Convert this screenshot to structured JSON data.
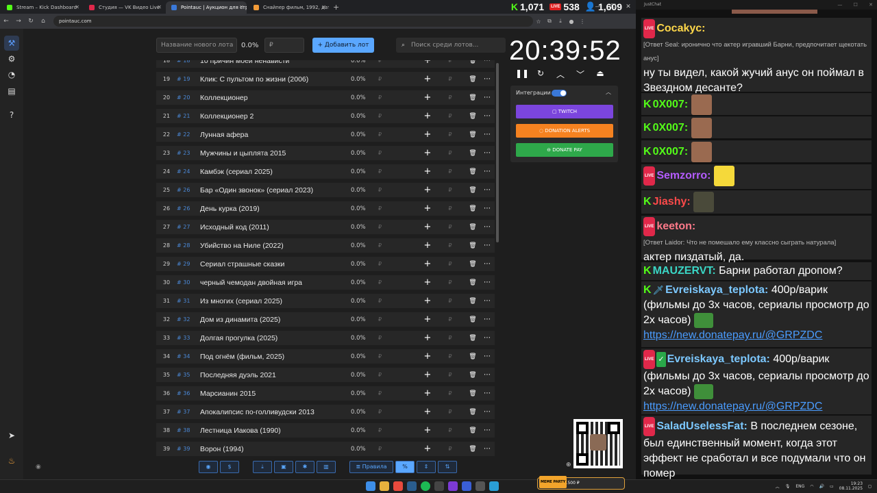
{
  "browser": {
    "tabs": [
      {
        "title": "Stream – Kick Dashboard",
        "color": "#53fc18"
      },
      {
        "title": "Студия — VK Видео Live",
        "color": "#e0284a"
      },
      {
        "title": "Pointauc | Аукцион для стрим...",
        "color": "#3a78d8"
      },
      {
        "title": "Снайпер фильм, 1992, дата вы...",
        "color": "#f29b38"
      }
    ],
    "url": "pointauc.com",
    "viewer_stats": {
      "kick": "1,071",
      "vk": "538",
      "total": "1,609"
    }
  },
  "sidebar": {
    "items": [
      "auction-icon",
      "settings-icon",
      "wheel-icon",
      "rules-icon",
      "help-icon"
    ],
    "bottom": [
      "telegram-icon",
      "donate-icon"
    ]
  },
  "toolbar": {
    "lot_placeholder": "Название нового лота",
    "percent": "0.0%",
    "amount_placeholder": "₽",
    "add_label": "Добавить лот",
    "search_placeholder": "Поиск среди лотов..."
  },
  "lots": [
    {
      "n": "18",
      "id": "18",
      "name": "10 причин моей ненависти"
    },
    {
      "n": "19",
      "id": "19",
      "name": "Клик: С пультом по жизни (2006)"
    },
    {
      "n": "20",
      "id": "20",
      "name": "Коллекционер"
    },
    {
      "n": "21",
      "id": "21",
      "name": "Коллекционер 2"
    },
    {
      "n": "22",
      "id": "22",
      "name": "Лунная афера"
    },
    {
      "n": "23",
      "id": "23",
      "name": "Мужчины и цыплята 2015"
    },
    {
      "n": "24",
      "id": "24",
      "name": "Камбэк (сериал 2025)"
    },
    {
      "n": "25",
      "id": "26",
      "name": "Бар «Один звонок» (сериал 2023)"
    },
    {
      "n": "26",
      "id": "26",
      "name": "День курка (2019)"
    },
    {
      "n": "27",
      "id": "27",
      "name": "Исходный код (2011)"
    },
    {
      "n": "28",
      "id": "28",
      "name": "Убийство на Ниле (2022)"
    },
    {
      "n": "29",
      "id": "29",
      "name": "Сериал страшные сказки"
    },
    {
      "n": "30",
      "id": "30",
      "name": "черный чемодан двойная игра"
    },
    {
      "n": "31",
      "id": "31",
      "name": "Из многих (сериал 2025)"
    },
    {
      "n": "32",
      "id": "32",
      "name": "Дом из динамита (2025)"
    },
    {
      "n": "33",
      "id": "33",
      "name": "Долгая прогулка (2025)"
    },
    {
      "n": "34",
      "id": "34",
      "name": "Под огнём (фильм, 2025)"
    },
    {
      "n": "35",
      "id": "35",
      "name": "Последняя дуэль 2021"
    },
    {
      "n": "36",
      "id": "36",
      "name": "Марсианин 2015"
    },
    {
      "n": "37",
      "id": "37",
      "name": "Апокалипсис по-голливудски 2013"
    },
    {
      "n": "38",
      "id": "38",
      "name": "Лестница Иакова (1990)"
    },
    {
      "n": "39",
      "id": "39",
      "name": "Ворон (1994)"
    }
  ],
  "lot_defaults": {
    "percent": "0.0%",
    "currency": "₽"
  },
  "bottombar": {
    "rules_label": "Правила"
  },
  "timer": {
    "value": "20:39:52"
  },
  "integrations": {
    "title": "Интеграции",
    "twitch": "TWITCH",
    "donation_alerts": "DONATION ALERTS",
    "donate_pay": "DONATE PAY",
    "colors": {
      "twitch": "#7b45dd",
      "donation_alerts": "#f58220",
      "donate_pay": "#2ea84a"
    }
  },
  "chat": {
    "window_title": "JustChat",
    "messages": [
      {
        "platform": "vk",
        "nick": "Cocakyc:",
        "nick_color": "#ffd84a",
        "reply": "[Ответ Seal: иронично что актер игравший Барни, предпочитает щекотать анус]",
        "text": "ну ты видел, какой жучий анус он поймал в Звездном десанте?"
      },
      {
        "platform": "kick",
        "nick": "0X007:",
        "nick_color": "#53fc18",
        "emote": "face"
      },
      {
        "platform": "kick",
        "nick": "0X007:",
        "nick_color": "#53fc18",
        "emote": "face"
      },
      {
        "platform": "kick",
        "nick": "0X007:",
        "nick_color": "#53fc18",
        "emote": "face"
      },
      {
        "platform": "vk",
        "nick": "Semzorro:",
        "nick_color": "#b45cff",
        "emote": "lol"
      },
      {
        "platform": "kick",
        "nick": "Jiashy:",
        "nick_color": "#ff4a4a",
        "emote": "turtle"
      },
      {
        "platform": "vk",
        "nick": "keeton:",
        "nick_color": "#ff7a8a",
        "reply": "[Ответ Laidor: Что не помешало ему классно сыграть натурала]",
        "text": "актер пиздатый, да."
      },
      {
        "platform": "kick",
        "nick": "MAUZERVT:",
        "nick_color": "#3ad6c5",
        "text": "Барни работал дропом?"
      },
      {
        "platform": "kick",
        "nick": "Evreiskaya_teplota:",
        "nick_color": "#7cc8ff",
        "text": "400р/варик (фильмы до 3х часов, сериалы просмотр до 2х часов)",
        "link": "https://new.donatepay.ru/@GRPZDC"
      },
      {
        "platform": "vk",
        "nick": "Evreiskaya_teplota:",
        "nick_color": "#7cc8ff",
        "text": "400р/варик (фильмы до 3х часов, сериалы просмотр до 2х часов)",
        "link": "https://new.donatepay.ru/@GRPZDC"
      },
      {
        "platform": "vk",
        "nick": "SaladUselessFat:",
        "nick_color": "#7cc8ff",
        "text": "В последнем сезоне, был единственный момент, когда этот эффект не сработал и все подумали что он помер"
      }
    ]
  },
  "taskbar": {
    "widget_tag": "MEME PARTY",
    "widget_text": "0 / 1500 ₽",
    "lang": "ENG",
    "time": "19:23",
    "date": "08.11.2025"
  }
}
